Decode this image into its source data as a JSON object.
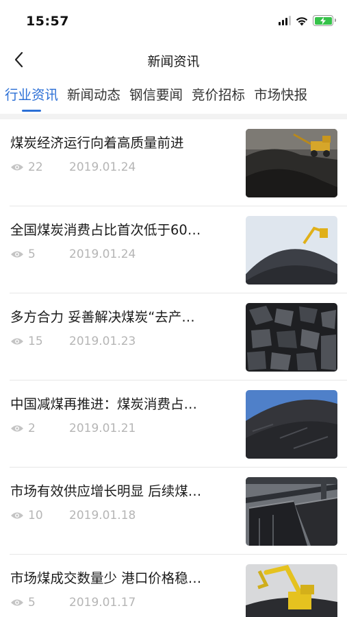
{
  "status_bar": {
    "time": "15:57"
  },
  "header": {
    "title": "新闻资讯"
  },
  "tabs": [
    {
      "label": "行业资讯",
      "active": true
    },
    {
      "label": "新闻动态",
      "active": false
    },
    {
      "label": "钢信要闻",
      "active": false
    },
    {
      "label": "竞价招标",
      "active": false
    },
    {
      "label": "市场快报",
      "active": false
    }
  ],
  "news": [
    {
      "title": "煤炭经济运行向着高质量前进",
      "views": "22",
      "date": "2019.01.24",
      "image": "coal-pile-with-loader"
    },
    {
      "title": "全国煤炭消费占比首次低于60…",
      "views": "5",
      "date": "2019.01.24",
      "image": "coal-mound-with-excavator"
    },
    {
      "title": "多方合力 妥善解决煤炭“去产…",
      "views": "15",
      "date": "2019.01.23",
      "image": "coal-lumps-closeup"
    },
    {
      "title": "中国减煤再推进：煤炭消费占…",
      "views": "2",
      "date": "2019.01.21",
      "image": "coal-heap-blue-sky"
    },
    {
      "title": "市场有效供应增长明显 后续煤…",
      "views": "10",
      "date": "2019.01.18",
      "image": "coal-rail-cars"
    },
    {
      "title": "市场煤成交数量少 港口价格稳…",
      "views": "5",
      "date": "2019.01.17",
      "image": "yellow-excavator-on-coal"
    }
  ],
  "colors": {
    "accent": "#2b6fd6",
    "meta_text": "#b5b5b5",
    "battery": "#36c24a"
  }
}
